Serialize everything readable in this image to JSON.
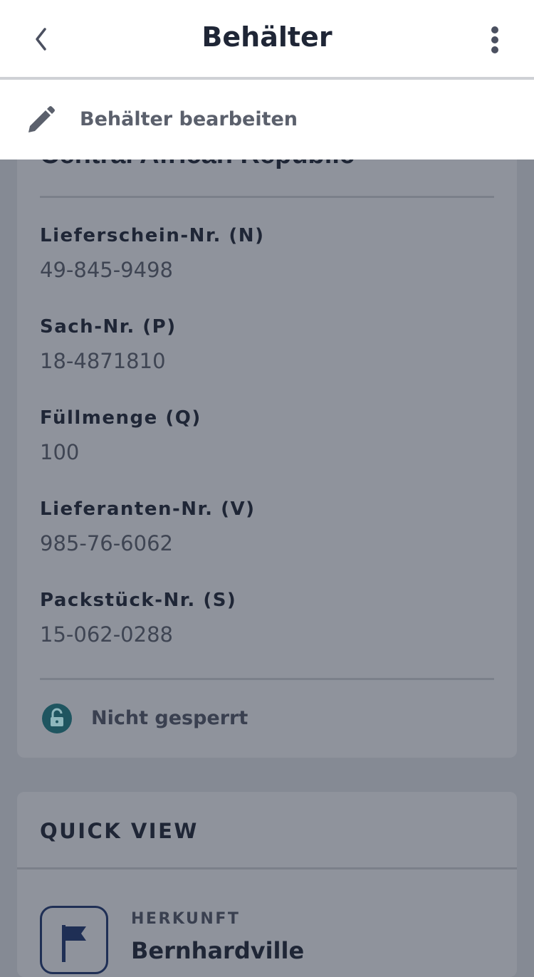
{
  "header": {
    "title": "Behälter"
  },
  "menu": {
    "edit_label": "Behälter bearbeiten"
  },
  "container": {
    "name": "Central African Republic",
    "fields": [
      {
        "label": "Lieferschein-Nr. (N)",
        "value": "49-845-9498"
      },
      {
        "label": "Sach-Nr. (P)",
        "value": "18-4871810"
      },
      {
        "label": "Füllmenge (Q)",
        "value": "100"
      },
      {
        "label": "Lieferanten-Nr. (V)",
        "value": "985-76-6062"
      },
      {
        "label": "Packstück-Nr. (S)",
        "value": "15-062-0288"
      }
    ],
    "lock_status": "Nicht gesperrt"
  },
  "quick_view": {
    "title": "QUICK VIEW",
    "origin_label": "HERKUNFT",
    "origin_value": "Bernhardville"
  },
  "colors": {
    "overlay_bg": "#858a94",
    "card_bg": "#8f939c",
    "text_dark": "#1f2636",
    "lock_accent": "#1f5560"
  },
  "icons": {
    "back": "chevron-left-icon",
    "more": "more-vertical-icon",
    "edit": "pencil-icon",
    "lock": "lock-open-icon",
    "origin": "flag-icon"
  }
}
